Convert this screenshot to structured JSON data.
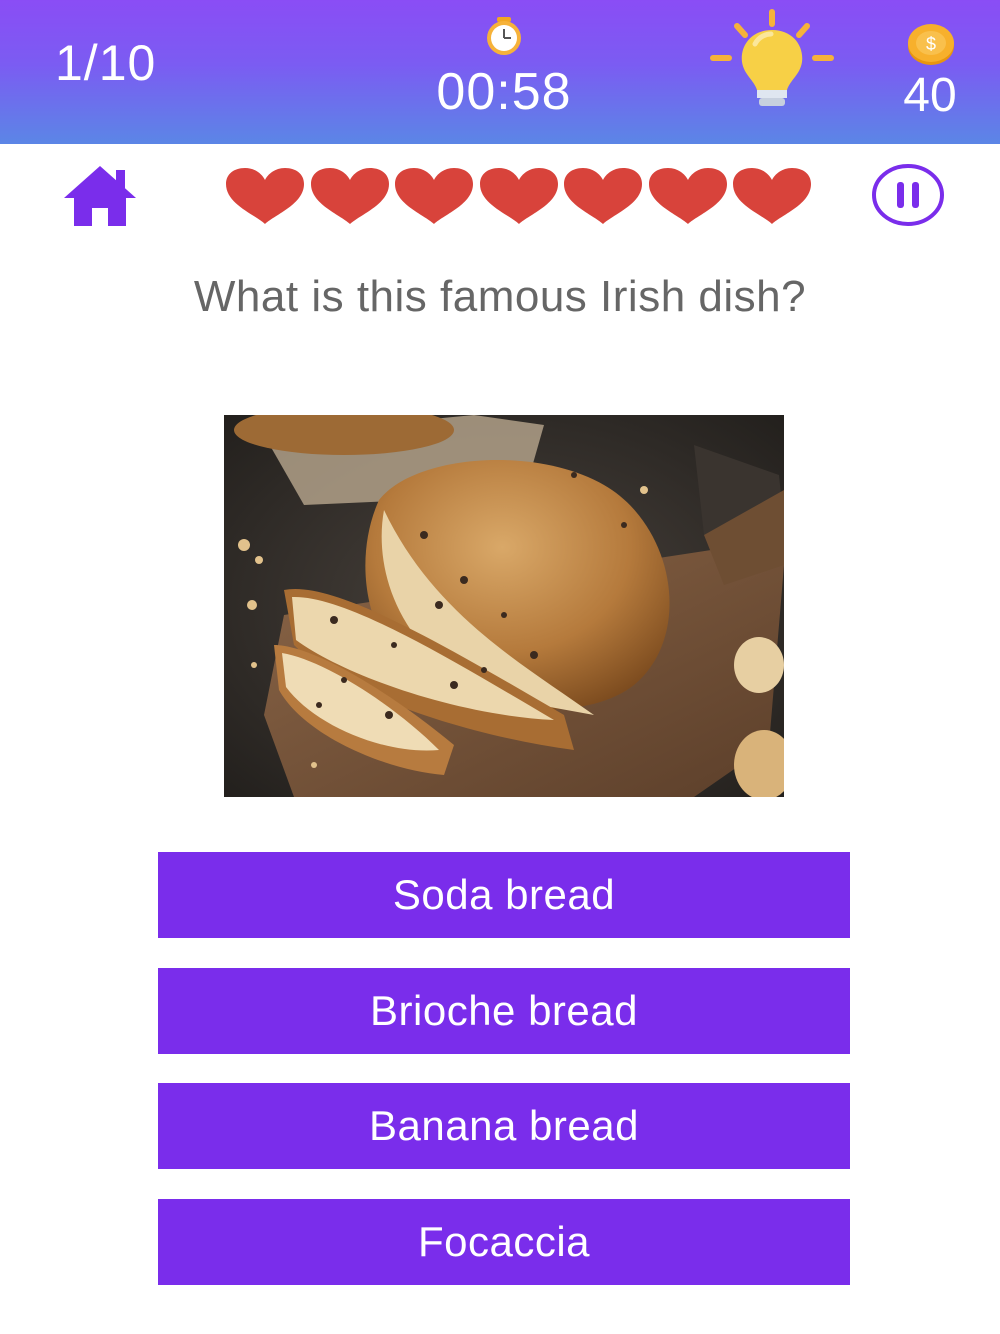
{
  "header": {
    "progress": "1/10",
    "timer": "00:58",
    "coins": "40",
    "coin_symbol": "$"
  },
  "icons": {
    "clock": "clock-icon",
    "hint": "lightbulb-icon",
    "coin": "coin-icon",
    "home": "home-icon",
    "pause": "pause-icon",
    "life": "heart-icon"
  },
  "lives": {
    "count": 7,
    "color": "#d8433b"
  },
  "question": {
    "text": "What is this famous Irish dish?"
  },
  "answers": [
    {
      "label": "Soda bread"
    },
    {
      "label": "Brioche bread"
    },
    {
      "label": "Banana bread"
    },
    {
      "label": "Focaccia"
    }
  ],
  "colors": {
    "header_gradient_top": "#8a4df5",
    "header_gradient_bottom": "#5b86e6",
    "accent_purple": "#7a2deb",
    "question_text": "#666666"
  }
}
